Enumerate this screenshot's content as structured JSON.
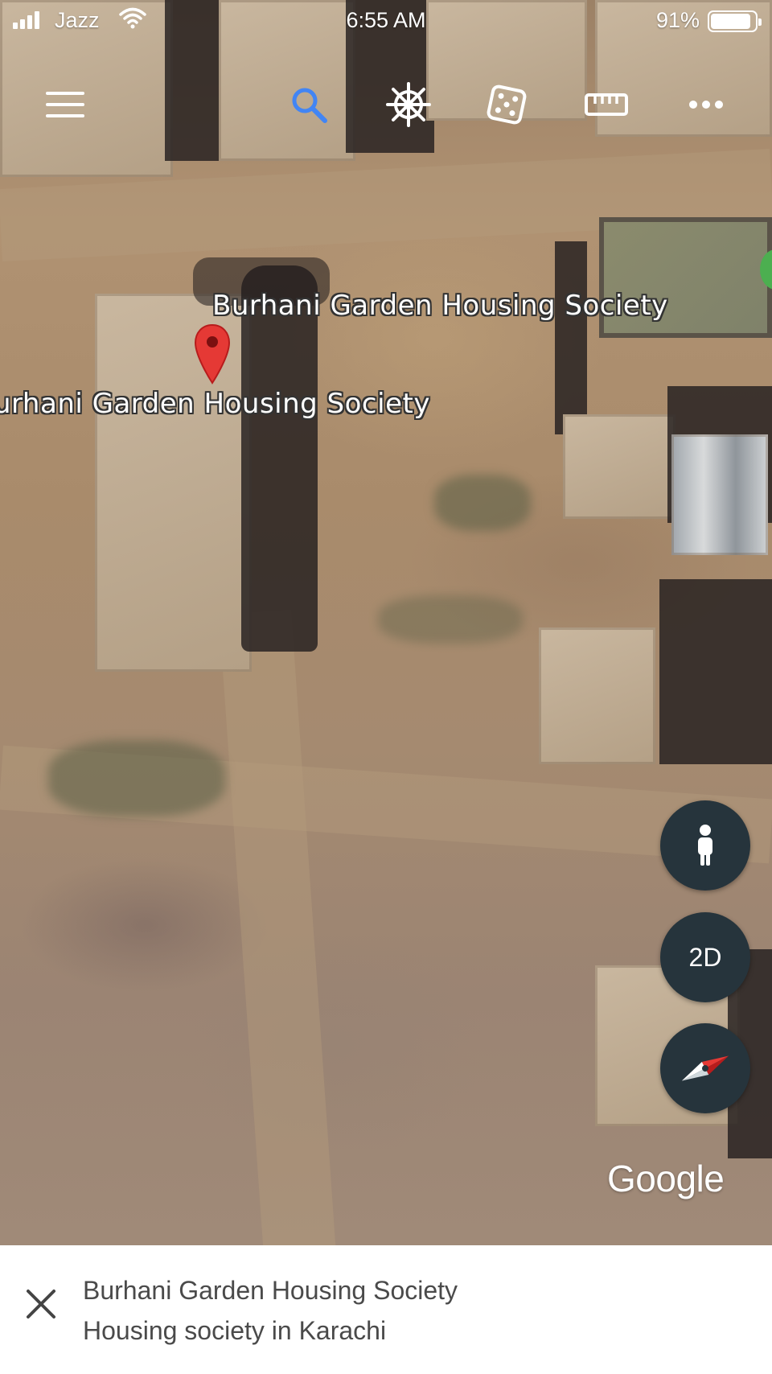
{
  "status_bar": {
    "carrier": "Jazz",
    "time": "6:55 AM",
    "battery_percent": "91%",
    "battery_level": 0.91,
    "signal_bars": 4
  },
  "toolbar": {
    "icons": [
      "menu-icon",
      "search-icon",
      "voyager-wheel-icon",
      "dice-icon",
      "ruler-icon",
      "more-dots-icon"
    ],
    "search_accent": "#4285f4"
  },
  "map": {
    "labels": [
      "Burhani Garden Housing Society",
      "urhani Garden Housing Society"
    ],
    "pin_color": "#e53935"
  },
  "controls": {
    "view_toggle_label": "2D",
    "pegman_icon": "pegman-icon",
    "compass_icon": "compass-icon"
  },
  "attribution": "Google",
  "place_card": {
    "title": "Burhani Garden Housing Society",
    "subtitle": "Housing society in Karachi",
    "close_icon": "close-icon"
  }
}
